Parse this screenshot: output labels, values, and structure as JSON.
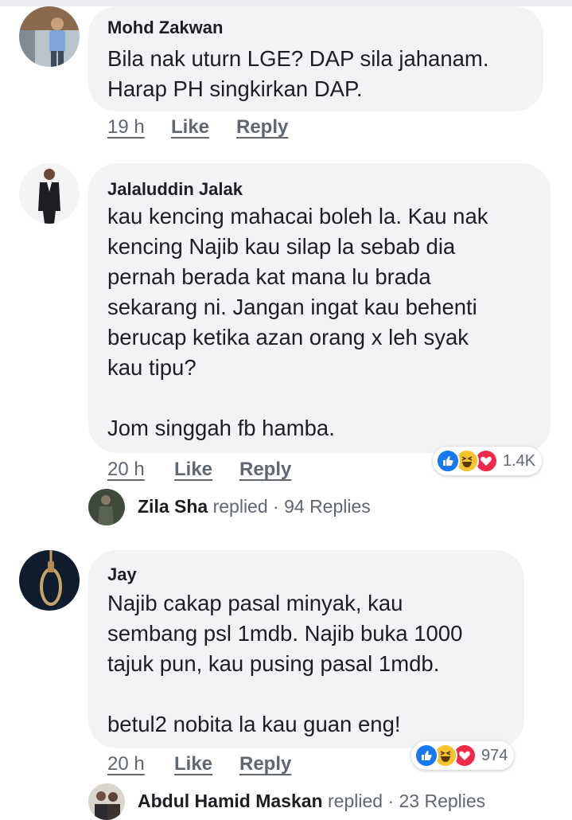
{
  "comments": [
    {
      "author": "Mohd Zakwan",
      "text": "Bila nak uturn LGE? DAP sila jahanam.\nHarap PH singkirkan DAP.",
      "time": "19 h",
      "like_label": "Like",
      "reply_label": "Reply"
    },
    {
      "author": "Jalaluddin Jalak",
      "text": "kau kencing mahacai boleh la. Kau nak\nkencing Najib kau silap la sebab dia\npernah berada kat mana lu brada\nsekarang ni. Jangan ingat kau behenti\nberucap ketika azan orang x leh syak\nkau tipu?\n\nJom singgah fb hamba.",
      "time": "20 h",
      "like_label": "Like",
      "reply_label": "Reply",
      "reaction_count": "1.4K",
      "reaction_icons": [
        "like-icon",
        "haha-icon",
        "love-icon"
      ],
      "replies": {
        "name": "Zila Sha",
        "verb": "replied",
        "count": "94 Replies"
      }
    },
    {
      "author": "Jay",
      "text": "Najib cakap pasal minyak, kau\nsembang psl 1mdb. Najib buka 1000\ntajuk pun, kau pusing pasal 1mdb.\n\nbetul2 nobita la kau guan eng!",
      "time": "20 h",
      "like_label": "Like",
      "reply_label": "Reply",
      "reaction_count": "974",
      "reaction_icons": [
        "like-icon",
        "haha-icon",
        "love-icon"
      ],
      "replies": {
        "name": "Abdul Hamid Maskan",
        "verb": "replied",
        "count": "23 Replies"
      }
    }
  ],
  "separator": "·",
  "colors": {
    "bubble": "#f2f3f5",
    "meta_text": "#606770",
    "like_blue": "#1877f2",
    "haha_yellow": "#f7c42f",
    "love_red": "#f0284a"
  }
}
